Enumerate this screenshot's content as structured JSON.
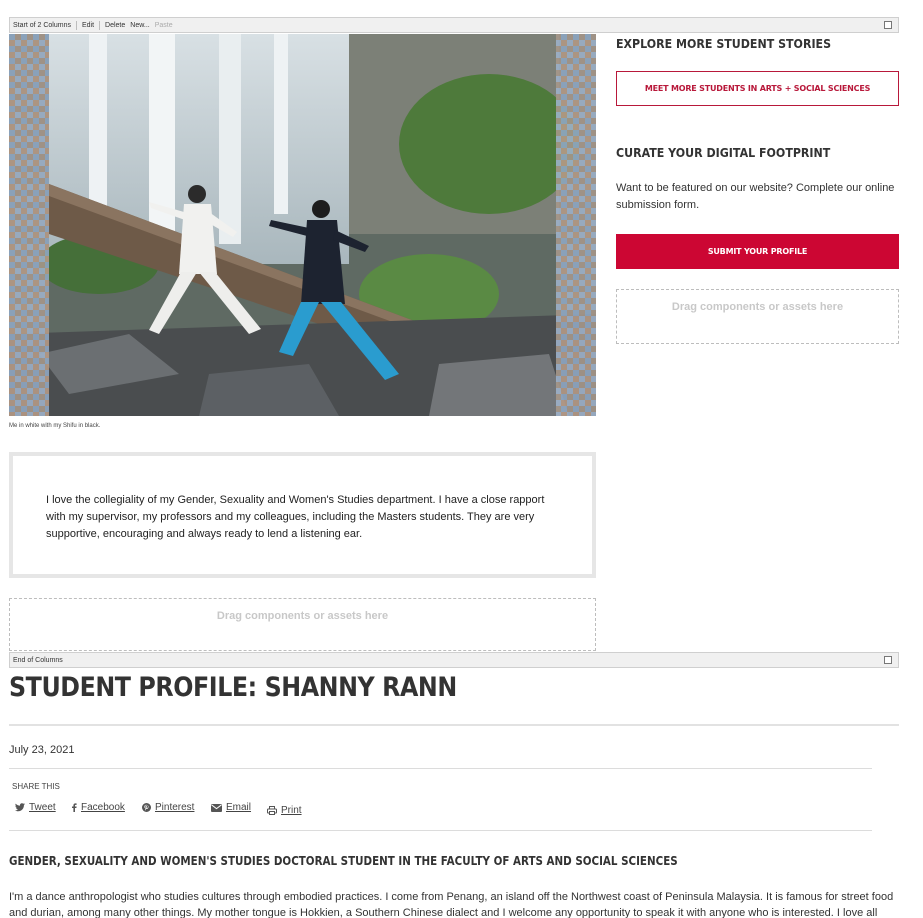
{
  "toolbar_start": {
    "label": "Start of 2 Columns",
    "edit": "Edit",
    "delete": "Delete",
    "new": "New...",
    "paste": "Paste"
  },
  "toolbar_end": {
    "label": "End of Columns"
  },
  "photo": {
    "caption": "Me in white with my Shifu in black."
  },
  "quote": {
    "text": "I love the collegiality of my Gender, Sexuality and Women's Studies department. I have a close rapport with my supervisor, my professors and my colleagues, including the Masters students. They are very supportive, encouraging and always ready to lend a listening ear."
  },
  "drop_zone_text": "Drag components or assets here",
  "sidebar": {
    "explore_heading": "EXPLORE MORE STUDENT STORIES",
    "meet_button": "MEET MORE STUDENTS IN ARTS + SOCIAL SCIENCES",
    "curate_heading": "CURATE YOUR DIGITAL FOOTPRINT",
    "curate_text": "Want to be featured on our website? Complete our online submission form.",
    "submit_button": "SUBMIT YOUR PROFILE"
  },
  "article": {
    "title": "STUDENT PROFILE: SHANNY RANN",
    "date": "July 23, 2021",
    "share_label": "SHARE THIS",
    "share": {
      "tweet": "Tweet",
      "facebook": "Facebook",
      "pinterest": "Pinterest",
      "email": "Email",
      "print": "Print"
    },
    "subheading": "GENDER, SEXUALITY AND WOMEN'S STUDIES DOCTORAL STUDENT IN THE FACULTY OF ARTS AND SOCIAL SCIENCES",
    "body": "I'm a dance anthropologist who studies cultures through embodied practices. I come from Penang, an island off the Northwest coast of Peninsula Malaysia. It is famous for street food and durian, among many other things. My mother tongue is Hokkien, a Southern Chinese dialect and I welcome any opportunity to speak it with anyone who is interested. I love all"
  },
  "colors": {
    "accent": "#cc0633",
    "accent_outline": "#b8183a",
    "heading": "#333333",
    "drop_zone": "#c8c8c8"
  }
}
